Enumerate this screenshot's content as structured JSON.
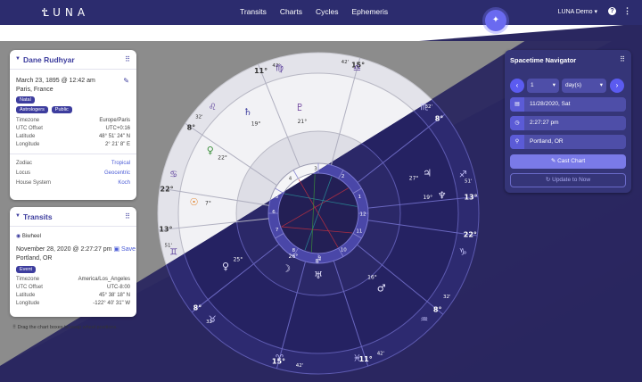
{
  "app": {
    "logo_text": "LUNA",
    "user_menu": "LUNA Demo"
  },
  "nav": {
    "items": [
      "Transits",
      "Charts",
      "Cycles",
      "Ephemeris"
    ]
  },
  "toolbar": {
    "icons": [
      "globe-icon",
      "layers-icon",
      "a-icon",
      "grid-icon",
      "settings-icon",
      "tree-icon",
      "share-icon"
    ]
  },
  "natal_card": {
    "name": "Dane Rudhyar",
    "date": "March 23, 1895 @ 12:42 am",
    "place": "Paris, France",
    "tags": [
      "Natal",
      "Astrologers",
      "Public"
    ],
    "rows": [
      {
        "label": "Timezone",
        "value": "Europe/Paris"
      },
      {
        "label": "UTC Offset",
        "value": "UTC+0:16"
      },
      {
        "label": "Latitude",
        "value": "48° 51' 24\" N"
      },
      {
        "label": "Longitude",
        "value": "2° 21' 8\" E"
      }
    ],
    "settings": [
      {
        "label": "Zodiac",
        "value": "Tropical"
      },
      {
        "label": "Locus",
        "value": "Geocentric"
      },
      {
        "label": "House System",
        "value": "Koch"
      }
    ]
  },
  "transits_card": {
    "title": "Transits",
    "mode": "Biwheel",
    "date": "November 28, 2020 @ 2:27:27 pm",
    "save_label": "Save",
    "place": "Portland, OR",
    "tag": "Event",
    "rows": [
      {
        "label": "Timezone",
        "value": "America/Los_Angeles"
      },
      {
        "label": "UTC Offset",
        "value": "UTC-8:00"
      },
      {
        "label": "Latitude",
        "value": "45° 38' 18\" N"
      },
      {
        "label": "Longitude",
        "value": "-122° 40' 31\" W"
      }
    ],
    "hint": "Drag the chart boxes to swap wheel positions."
  },
  "navigator": {
    "title": "Spacetime Navigator",
    "step_value": "1",
    "step_unit": "day(s)",
    "date": "11/28/2020, Sat",
    "time": "2:27:27 pm",
    "place": "Portland, OR",
    "cast_label": "Cast Chart",
    "update_label": "Update to Now"
  },
  "wheel": {
    "outer_degrees": [
      {
        "t": "15°",
        "a": 75
      },
      {
        "t": "42'",
        "a": 80
      },
      {
        "t": "11°",
        "a": 112
      },
      {
        "t": "42'",
        "a": 106
      },
      {
        "t": "8°",
        "a": 146
      },
      {
        "t": "32'",
        "a": 141
      },
      {
        "t": "22°",
        "a": 171
      },
      {
        "t": "13°",
        "a": 186
      },
      {
        "t": "51'",
        "a": 192
      },
      {
        "t": "8°",
        "a": 218
      },
      {
        "t": "32'",
        "a": 225
      },
      {
        "t": "15°",
        "a": 255
      },
      {
        "t": "42'",
        "a": 263
      },
      {
        "t": "11°",
        "a": 288
      },
      {
        "t": "42'",
        "a": 294
      },
      {
        "t": "8°",
        "a": 321
      },
      {
        "t": "32'",
        "a": 327
      },
      {
        "t": "22°",
        "a": 352
      },
      {
        "t": "13°",
        "a": 6
      },
      {
        "t": "51'",
        "a": 12
      },
      {
        "t": "8°",
        "a": 38
      },
      {
        "t": "32'",
        "a": 44
      }
    ],
    "zodiac_glyphs": [
      "♍",
      "♎",
      "♏",
      "♐",
      "♑",
      "♒",
      "♓",
      "♈",
      "♉",
      "♊",
      "♋",
      "♌"
    ],
    "house_numbers": [
      "1",
      "2",
      "3",
      "4",
      "5",
      "6",
      "7",
      "8",
      "9",
      "10",
      "11",
      "12"
    ],
    "planets": [
      {
        "g": "♀",
        "d": "22°",
        "c": "#3a8f3a"
      },
      {
        "g": "♇",
        "d": "21°",
        "c": "#6a3d9a"
      },
      {
        "g": "☉",
        "d": "7°",
        "c": "#e07a1a"
      },
      {
        "g": "♄",
        "d": "19°",
        "c": "#3d3d9e"
      },
      {
        "g": "♃",
        "d": "27°",
        "c": "#3d3d9e"
      },
      {
        "g": "♆",
        "d": "19°",
        "c": "#6a3d9a"
      },
      {
        "g": "♂",
        "d": "16°",
        "c": "#c03040"
      },
      {
        "g": "☽",
        "d": "26°",
        "c": "#3d3d9e"
      },
      {
        "g": "♅",
        "d": "8°",
        "c": "#2a8f9a"
      },
      {
        "g": "♀",
        "d": "25°",
        "c": "#3a8f3a"
      }
    ]
  },
  "colors": {
    "brand": "#2c2c6e",
    "accent": "#5b5bd6",
    "dark_bg": "#2a2760",
    "light_wheel": "#e9e9ef"
  }
}
